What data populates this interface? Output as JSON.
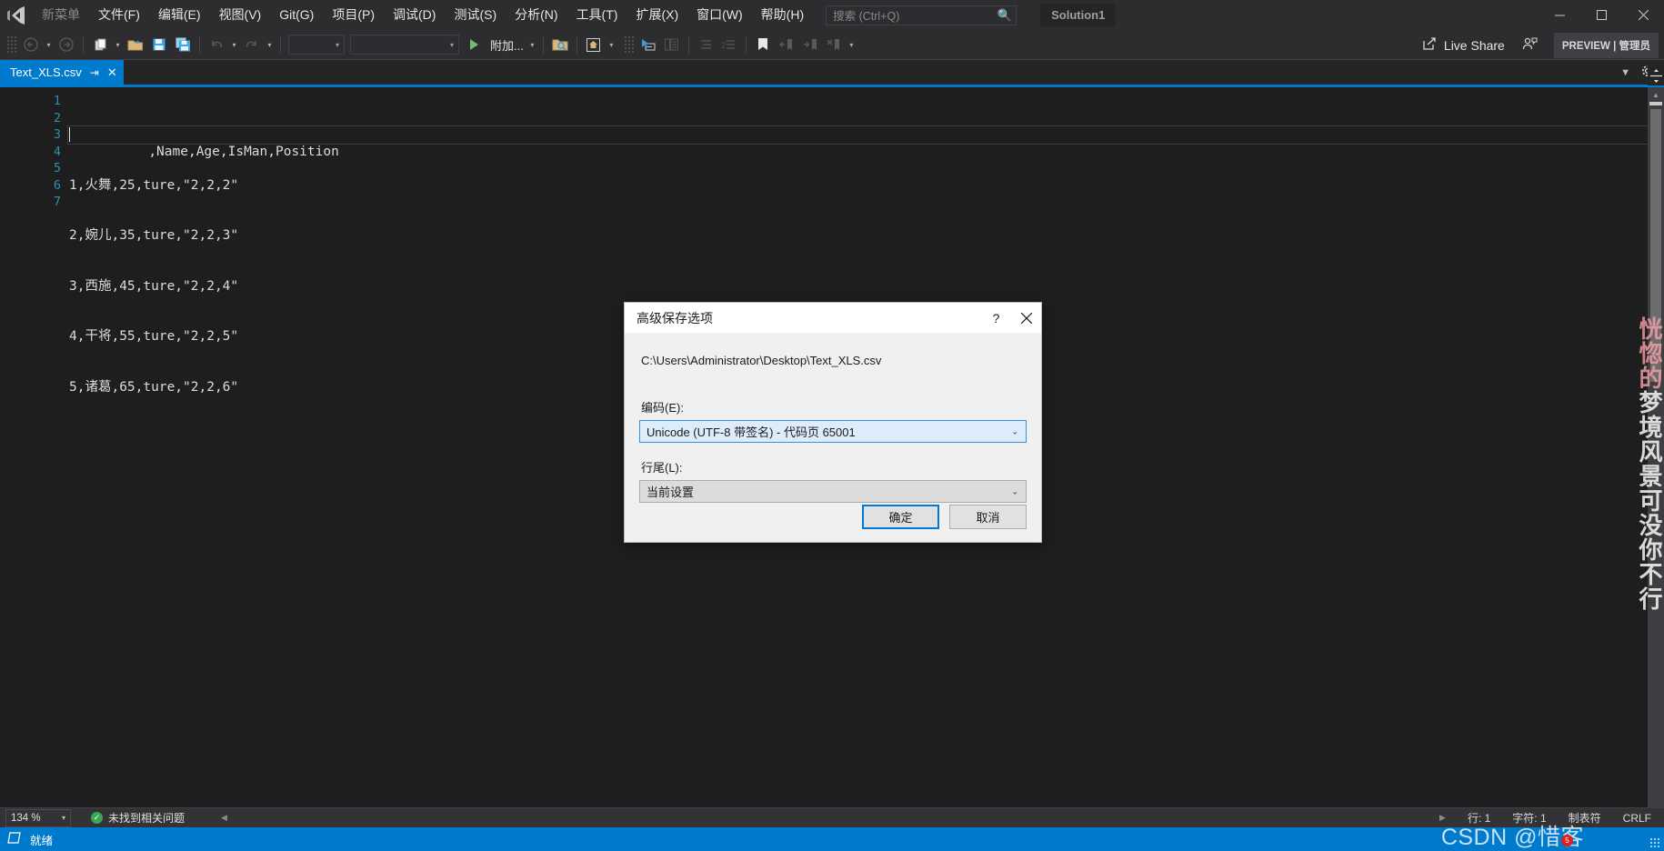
{
  "titlebar": {
    "logo_icon": "visual-studio-logo",
    "new_menu": "新菜单",
    "menus": [
      {
        "label": "文件(F)"
      },
      {
        "label": "编辑(E)"
      },
      {
        "label": "视图(V)"
      },
      {
        "label": "Git(G)"
      },
      {
        "label": "项目(P)"
      },
      {
        "label": "调试(D)"
      },
      {
        "label": "测试(S)"
      },
      {
        "label": "分析(N)"
      },
      {
        "label": "工具(T)"
      },
      {
        "label": "扩展(X)"
      },
      {
        "label": "窗口(W)"
      },
      {
        "label": "帮助(H)"
      }
    ],
    "search_placeholder": "搜索 (Ctrl+Q)",
    "search_value": "",
    "search_icon": "magnifier-icon",
    "solution_name": "Solution1",
    "minimize": "—",
    "maximize": "▢",
    "close": "✕"
  },
  "toolbar": {
    "back_icon": "navigate-back-icon",
    "forward_icon": "navigate-forward-icon",
    "new_item_icon": "new-item-icon",
    "open_icon": "open-folder-icon",
    "save_icon": "save-icon",
    "save_all_icon": "save-all-icon",
    "undo_icon": "undo-icon",
    "redo_icon": "redo-icon",
    "combo1_value": "",
    "combo2_value": "",
    "run_icon": "play-icon",
    "attach_label": "附加...",
    "solution_explorer_icon": "search-folder-icon",
    "home_icon": "home-window-icon",
    "pointer_icon": "pointer-window-icon",
    "copy_window_icon": "copy-window-icon",
    "indent1_icon": "indent-icon",
    "indent2_icon": "outdent-icon",
    "bookmark_icon": "bookmark-icon",
    "prev_bookmark_icon": "prev-bookmark-icon",
    "next_bookmark_icon": "next-bookmark-icon",
    "clear_bookmark_icon": "clear-bookmark-icon",
    "live_share_label": "Live Share",
    "live_share_icon": "live-share-icon",
    "account_icon": "account-feedback-icon",
    "preview_label": "PREVIEW | 管理员"
  },
  "tabstrip": {
    "tab_label": "Text_XLS.csv",
    "pin_icon": "pin-icon",
    "close_icon": "close-tab-icon",
    "chevron_icon": "chevron-down-icon",
    "settings_icon": "gear-icon",
    "split_icon": "split-view-icon"
  },
  "editor": {
    "line_numbers": [
      "1",
      "2",
      "3",
      "4",
      "5",
      "6",
      "7"
    ],
    "lines": [
      ",Name,Age,IsMan,Position",
      "1,火舞,25,ture,\"2,2,2\"",
      "2,婉儿,35,ture,\"2,2,3\"",
      "3,西施,45,ture,\"2,2,4\"",
      "4,干将,55,ture,\"2,2,5\"",
      "5,诸葛,65,ture,\"2,2,6\"",
      ""
    ],
    "active_line": 0,
    "watermark_pink": "恍惚的",
    "watermark_white": "梦境风景可没你不行"
  },
  "dialog": {
    "title": "高级保存选项",
    "help_icon": "?",
    "close_icon": "✕",
    "file_path": "C:\\Users\\Administrator\\Desktop\\Text_XLS.csv",
    "encoding_label": "编码(E):",
    "encoding_value": "Unicode (UTF-8 带签名) - 代码页 65001",
    "line_ending_label": "行尾(L):",
    "line_ending_value": "当前设置",
    "ok_label": "确定",
    "cancel_label": "取消",
    "accent_color": "#0078d7",
    "focus_bg": "#dcecfb"
  },
  "zoombar": {
    "zoom_value": "134 %",
    "zoom_caret": "▾",
    "status_icon": "ok-check-icon",
    "no_issues": "未找到相关问题",
    "collapse_icon": "◀",
    "expand_icon": "▶",
    "line_label": "行: 1",
    "char_label": "字符: 1",
    "tab_label": "制表符",
    "eol_label": "CRLF"
  },
  "statusbar": {
    "ready_icon": "source-control-icon",
    "ready_label": "就绪",
    "accent_color": "#007acc",
    "watermark": "CSDN @惜客",
    "badge": "5"
  }
}
